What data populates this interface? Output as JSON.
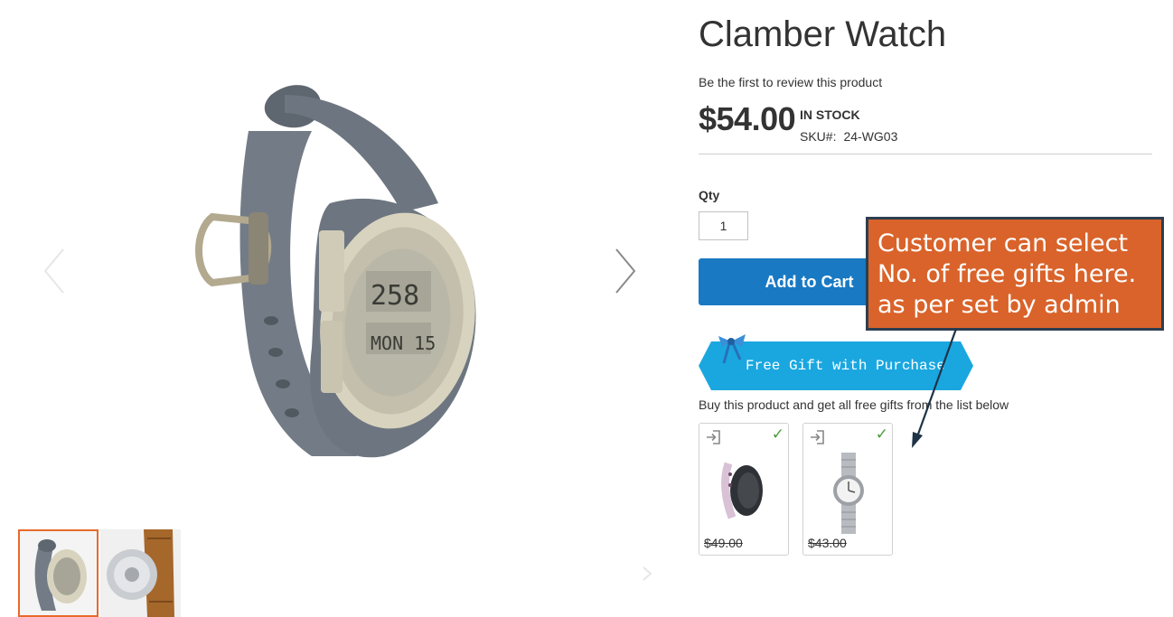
{
  "product": {
    "title": "Clamber Watch",
    "review_link": "Be the first to review this product",
    "price": "$54.00",
    "stock": "IN STOCK",
    "sku_label": "SKU#:",
    "sku_value": "24-WG03"
  },
  "purchase": {
    "qty_label": "Qty",
    "qty_value": "1",
    "add_to_cart_label": "Add to Cart"
  },
  "free_gift": {
    "banner_text": "Free Gift with Purchase",
    "description": "Buy this product and get all free gifts from the list below",
    "gifts": [
      {
        "price": "$49.00",
        "selected_icon": "check-icon",
        "enter_icon": "sign-in-icon"
      },
      {
        "price": "$43.00",
        "selected_icon": "check-icon",
        "enter_icon": "sign-in-icon"
      }
    ]
  },
  "annotation": {
    "lines": [
      "Customer can select",
      "No. of free gifts here.",
      "as per set by admin"
    ]
  },
  "colors": {
    "accent_button": "#1979c3",
    "banner": "#1aa7e0",
    "callout_bg": "#d9632a",
    "callout_border": "#2d3e50",
    "thumb_active_border": "#e8692b",
    "check": "#4a9c3c"
  },
  "icons": [
    "chevron-left-icon",
    "chevron-right-icon",
    "ribbon-bow-icon",
    "sign-in-icon",
    "check-icon"
  ]
}
